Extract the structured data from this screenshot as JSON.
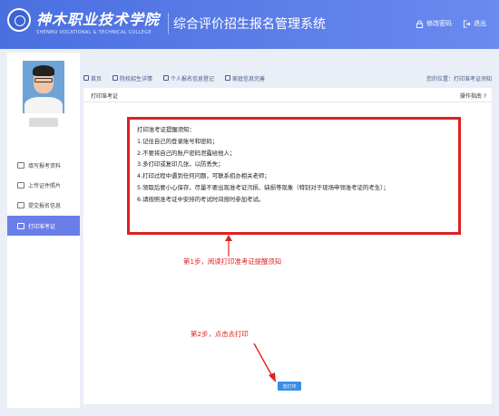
{
  "header": {
    "logo_cn": "神木职业技术学院",
    "logo_en": "SHENMU VOCATIONAL & TECHNICAL COLLEGE",
    "system_title": "综合评价招生报名管理系统",
    "change_password": "修改密码",
    "logout": "退出"
  },
  "sidebar": {
    "items": [
      {
        "label": "填写报考资料",
        "icon": "form-icon"
      },
      {
        "label": "上传证件照片",
        "icon": "upload-icon"
      },
      {
        "label": "提交报名信息",
        "icon": "submit-icon"
      },
      {
        "label": "打印准考证",
        "icon": "print-icon"
      }
    ],
    "active_index": 3
  },
  "topnav": {
    "items": [
      "首页",
      "院校招生详情",
      "个人报名信息登记",
      "家庭信息完善"
    ],
    "breadcrumb": "您的位置：打印准考证须知"
  },
  "panel": {
    "title": "打印准考证",
    "guide": "操作指南 ?"
  },
  "notice": {
    "lines": [
      "打印准考证提醒须知：",
      "1.记住自己的登录账号和密码；",
      "2.不要将自己的账户密码泄露给他人；",
      "3.多打印或复印几张，以防丢失；",
      "4.打印过程中遇到任何问题，可联系招办相关老师；",
      "5.领取后要小心保存，尽量不要出现准考证污损、缺损等现象（特别对于现场申领准考证的考生）；",
      "6.请按照准考证中安排的考试时间按时参加考试。"
    ]
  },
  "annotations": {
    "step1": "第1步，阅读打印准考证提醒须知",
    "step2": "第2步，点击去打印"
  },
  "print_button": "去打印",
  "colors": {
    "header": "#4a6fe0",
    "accent": "#6a7ee8",
    "annotation": "#e02020",
    "button": "#3a8ee6"
  }
}
